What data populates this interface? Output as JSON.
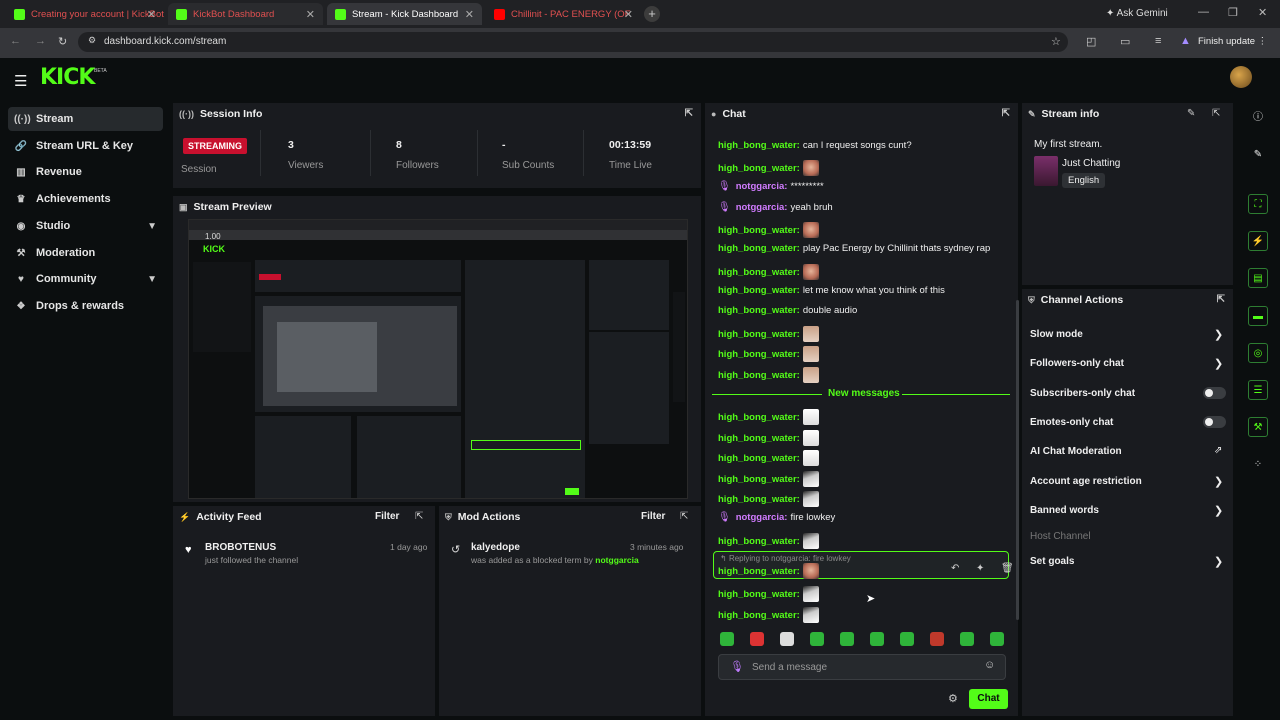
{
  "browser": {
    "tabs": [
      {
        "title": "Creating your account | KickBot",
        "color": "#53fc18"
      },
      {
        "title": "KickBot Dashboard",
        "color": "#53fc18"
      },
      {
        "title": "Stream - Kick Dashboard",
        "color": "#53fc18"
      },
      {
        "title": "Chillinit - PAC ENERGY (OF",
        "color": "#ff0000"
      }
    ],
    "ask_gemini": "Ask Gemini",
    "url": "dashboard.kick.com/stream",
    "finish_update": "Finish update"
  },
  "app": {
    "logo": "KICK",
    "beta": "BETA",
    "accent": "#53fc18"
  },
  "sidebar": {
    "items": [
      {
        "label": "Stream",
        "icon": "broadcast-icon"
      },
      {
        "label": "Stream URL & Key",
        "icon": "link-icon"
      },
      {
        "label": "Revenue",
        "icon": "revenue-icon"
      },
      {
        "label": "Achievements",
        "icon": "trophy-icon"
      },
      {
        "label": "Studio",
        "icon": "studio-icon"
      },
      {
        "label": "Moderation",
        "icon": "hammer-icon"
      },
      {
        "label": "Community",
        "icon": "community-icon"
      },
      {
        "label": "Drops & rewards",
        "icon": "gift-icon"
      }
    ]
  },
  "session": {
    "title": "Session Info",
    "badge": "STREAMING",
    "badge_label": "Session",
    "viewers_value": "3",
    "viewers_label": "Viewers",
    "followers_value": "8",
    "followers_label": "Followers",
    "subs_value": "-",
    "subs_label": "Sub Counts",
    "time_value": "00:13:59",
    "time_label": "Time Live"
  },
  "preview": {
    "title": "Stream Preview",
    "overlay_text": "1.00"
  },
  "activity": {
    "title": "Activity Feed",
    "filter": "Filter",
    "items": [
      {
        "user": "BROBOTENUS",
        "text": "just followed the channel",
        "time": "1 day ago"
      }
    ]
  },
  "mod_actions": {
    "title": "Mod Actions",
    "filter": "Filter",
    "items": [
      {
        "user": "kalyedope",
        "text": "was added as a blocked term by",
        "by": "notggarcia",
        "time": "3 minutes ago"
      }
    ]
  },
  "chat": {
    "title": "Chat",
    "messages": [
      {
        "user": "high_bong_water:",
        "text": "can I request songs cunt?"
      },
      {
        "user": "high_bong_water:",
        "emote": "e1"
      },
      {
        "user": "notggarcia:",
        "text": "*********",
        "mod": true
      },
      {
        "user": "notggarcia:",
        "text": "yeah bruh",
        "mod": true
      },
      {
        "user": "high_bong_water:",
        "emote": "e1"
      },
      {
        "user": "high_bong_water:",
        "text": "play Pac Energy by Chillinit thats sydney rap"
      },
      {
        "user": "high_bong_water:",
        "emote": "e1"
      },
      {
        "user": "high_bong_water:",
        "text": "let me know what you think of this"
      },
      {
        "user": "high_bong_water:",
        "text": "double audio"
      },
      {
        "user": "high_bong_water:",
        "emote": "e3"
      },
      {
        "user": "high_bong_water:",
        "emote": "e3"
      },
      {
        "user": "high_bong_water:",
        "emote": "e3"
      }
    ],
    "new_messages": "New messages",
    "messages_after": [
      {
        "user": "high_bong_water:",
        "emote": "e4"
      },
      {
        "user": "high_bong_water:",
        "emote": "e4"
      },
      {
        "user": "high_bong_water:",
        "emote": "e4"
      },
      {
        "user": "high_bong_water:",
        "emote": "e5"
      },
      {
        "user": "high_bong_water:",
        "emote": "e5"
      },
      {
        "user": "notggarcia:",
        "text": "fire lowkey",
        "mod": true
      },
      {
        "user": "high_bong_water:",
        "emote": "e5"
      }
    ],
    "reply_to": "Replying to notggarcia: fire lowkey",
    "reply_user": "high_bong_water:",
    "tail": [
      {
        "user": "high_bong_water:",
        "emote": "e5"
      },
      {
        "user": "high_bong_water:",
        "emote": "e5"
      }
    ],
    "placeholder": "Send a message",
    "send": "Chat"
  },
  "stream_info": {
    "title": "Stream info",
    "stream_title": "My first stream.",
    "category": "Just Chatting",
    "language": "English"
  },
  "channel_actions": {
    "title": "Channel Actions",
    "items": [
      {
        "label": "Slow mode",
        "kind": "arrow"
      },
      {
        "label": "Followers-only chat",
        "kind": "arrow"
      },
      {
        "label": "Subscribers-only chat",
        "kind": "toggle"
      },
      {
        "label": "Emotes-only chat",
        "kind": "toggle"
      },
      {
        "label": "AI Chat Moderation",
        "kind": "external"
      },
      {
        "label": "Account age restriction",
        "kind": "arrow"
      },
      {
        "label": "Banned words",
        "kind": "arrow"
      },
      {
        "label": "Host Channel",
        "kind": "disabled"
      },
      {
        "label": "Set goals",
        "kind": "arrow"
      }
    ]
  }
}
